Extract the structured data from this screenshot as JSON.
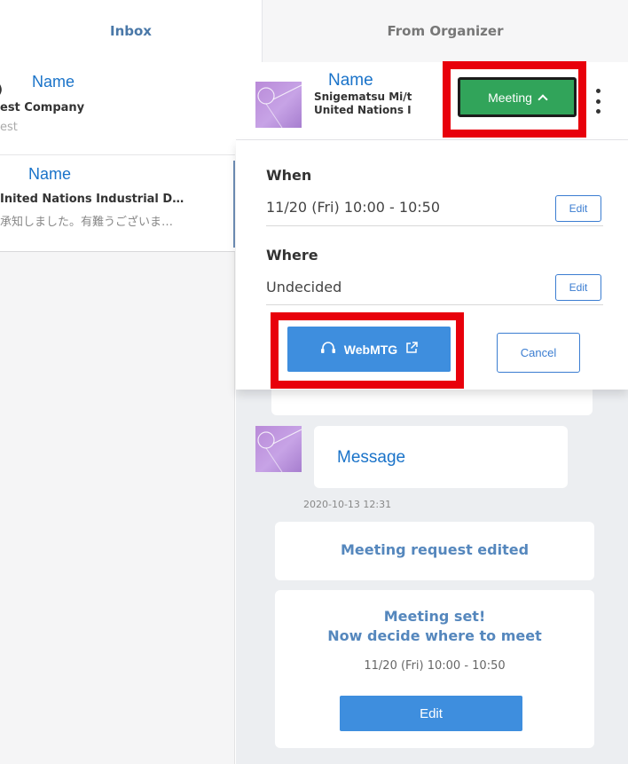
{
  "tabs": {
    "inbox": "Inbox",
    "from_organizer": "From Organizer"
  },
  "conversations": [
    {
      "name_overlay": "Name",
      "prefix": ")",
      "company": "est Company",
      "subtitle": "est"
    },
    {
      "name_overlay": "Name",
      "company": "Inited Nations Industrial D…",
      "preview": "承知しました。有難うございま…"
    }
  ],
  "chat_header": {
    "name_overlay": "Name",
    "partial_name": "Snigematsu Mi/t",
    "organization": "United Nations I",
    "meeting_button": "Meeting",
    "meeting_icon": "chevron-up-icon",
    "menu_icon": "kebab-menu-icon"
  },
  "meeting_panel": {
    "when_label": "When",
    "when_value": "11/20 (Fri) 10:00 - 10:50",
    "where_label": "Where",
    "where_value": "Undecided",
    "edit_label": "Edit",
    "webmtg_label": "WebMTG",
    "webmtg_icon": "headset-icon",
    "external_icon": "external-link-icon",
    "cancel_label": "Cancel"
  },
  "messages": {
    "message_overlay": "Message",
    "timestamp": "2020-10-13 12:31",
    "edited_notice": "Meeting request edited",
    "set_line1": "Meeting set!",
    "set_line2": "Now decide where to meet",
    "set_time": "11/20 (Fri) 10:00 - 10:50",
    "edit_button": "Edit"
  },
  "colors": {
    "meeting_green": "#31a45a",
    "primary_blue": "#3e8ede",
    "highlight_red": "#e8000b",
    "title_blue": "#5587bd",
    "overlay_text_blue": "#1a73c9"
  }
}
